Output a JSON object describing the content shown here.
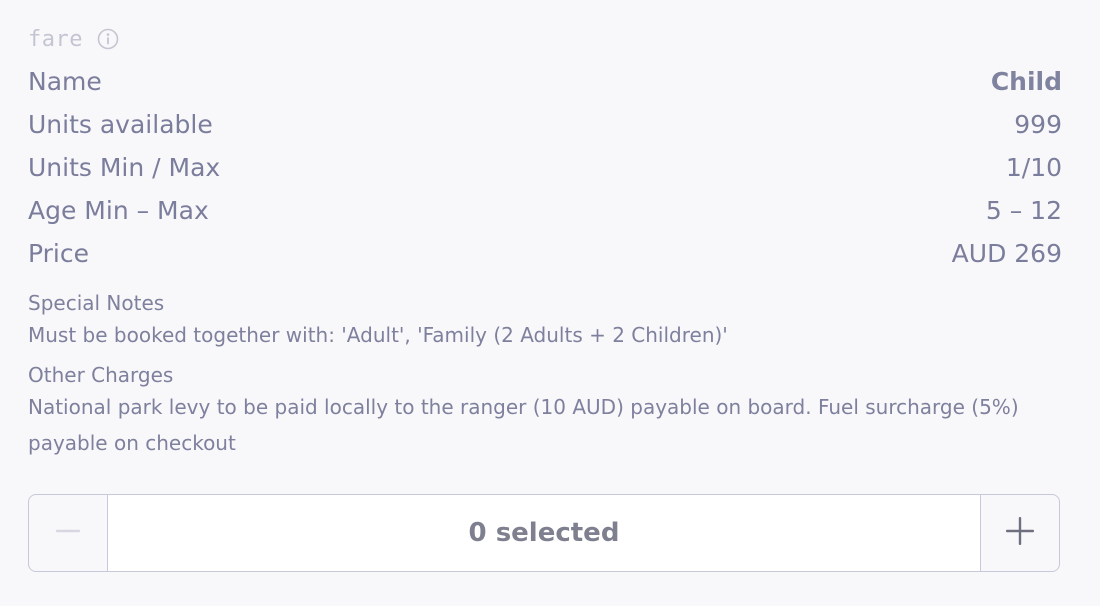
{
  "section": {
    "tag": "fare",
    "info_icon": "info-circle-icon"
  },
  "details": {
    "rows": [
      {
        "label": "Name",
        "value": "Child"
      },
      {
        "label": "Units available",
        "value": "999"
      },
      {
        "label": "Units Min / Max",
        "value": "1/10"
      },
      {
        "label": "Age Min – Max",
        "value": "5 – 12"
      },
      {
        "label": "Price",
        "value": "AUD 269"
      }
    ]
  },
  "notes": {
    "special_title": "Special Notes",
    "special_body": "Must be booked together with: 'Adult', 'Family (2 Adults + 2 Children)'",
    "charges_title": "Other Charges",
    "charges_body": "National park levy to be paid locally to the ranger (10 AUD) payable on board. Fuel surcharge (5%) payable on checkout"
  },
  "stepper": {
    "value_text": "0 selected",
    "minus_icon": "minus-icon",
    "plus_icon": "plus-icon"
  },
  "colors": {
    "background": "#f8f8fa",
    "text": "#7b7d9c",
    "muted_tag": "#c4c5d2",
    "border": "#c8c9d8"
  }
}
